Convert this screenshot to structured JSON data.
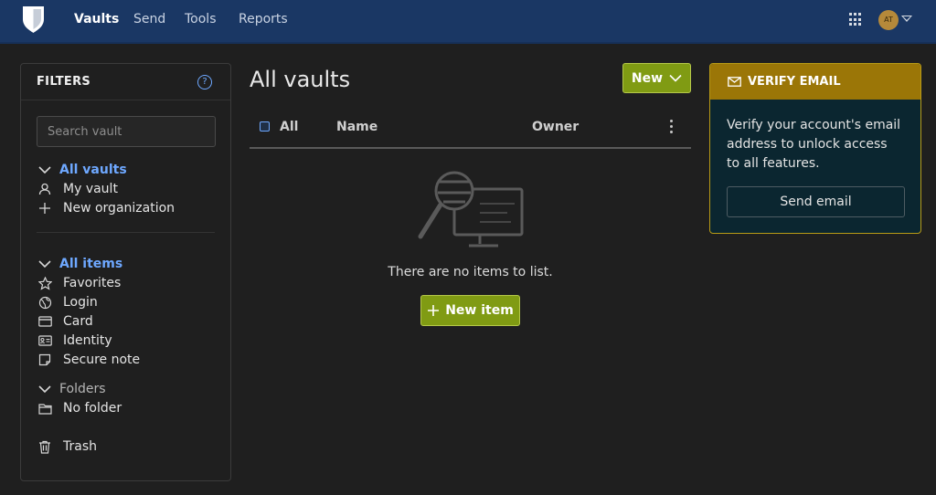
{
  "nav": {
    "links": [
      "Vaults",
      "Send",
      "Tools",
      "Reports"
    ],
    "active": "Vaults",
    "avatar_initials": "AT"
  },
  "filters": {
    "title": "FILTERS",
    "search_placeholder": "Search vault",
    "vaults_header": "All vaults",
    "vault_items": [
      "My vault",
      "New organization"
    ],
    "items_header": "All items",
    "type_items": [
      "Favorites",
      "Login",
      "Card",
      "Identity",
      "Secure note"
    ],
    "folders_header": "Folders",
    "folder_items": [
      "No folder"
    ],
    "trash": "Trash"
  },
  "main": {
    "title": "All vaults",
    "new_button": "New",
    "columns": {
      "all": "All",
      "name": "Name",
      "owner": "Owner"
    },
    "empty_text": "There are no items to list.",
    "new_item_button": "New item"
  },
  "verify": {
    "title": "VERIFY EMAIL",
    "body": "Verify your account's email address to unlock access to all features.",
    "button": "Send email"
  },
  "colors": {
    "navbar": "#1a3764",
    "primary_button": "#809b13",
    "link_blue": "#6ea8ff",
    "warning_header": "#9b7607"
  }
}
